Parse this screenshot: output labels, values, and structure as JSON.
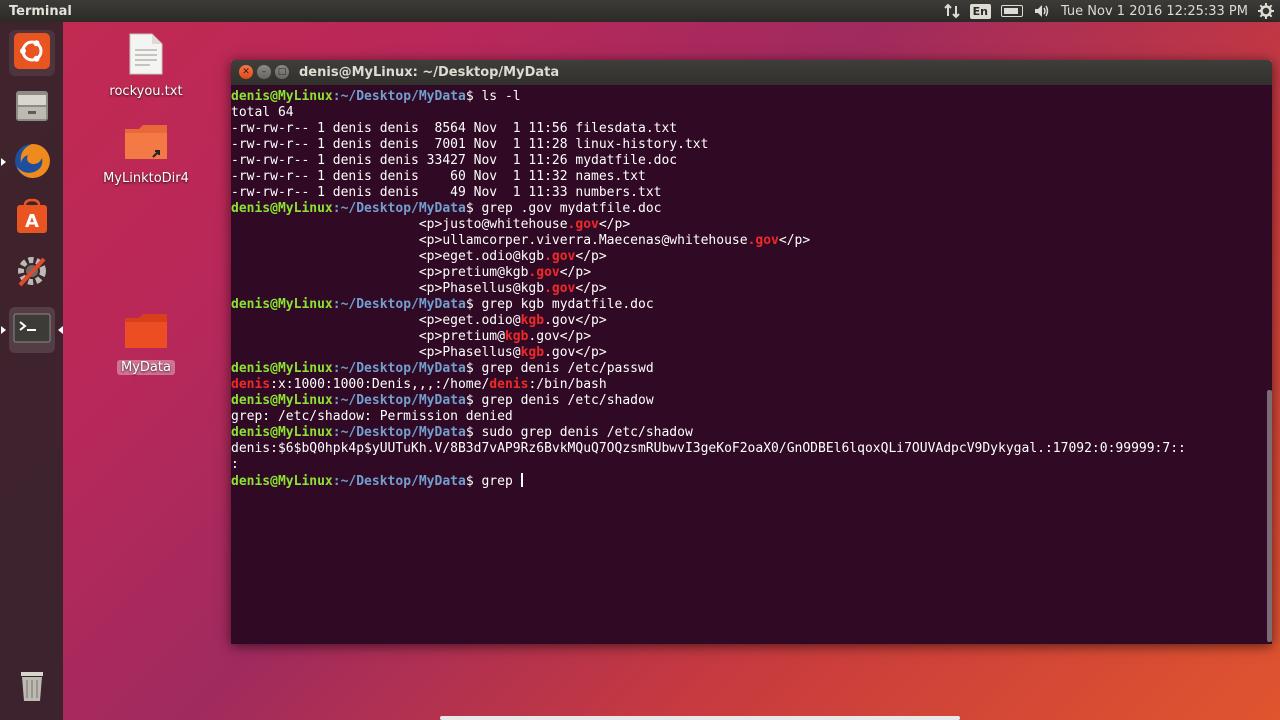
{
  "panel": {
    "app_title": "Terminal",
    "keyboard": "En",
    "datetime": "Tue Nov  1 2016 12:25:33 PM"
  },
  "launcher": {
    "items": [
      {
        "name": "dash-home",
        "icon": "ubuntu-logo-icon"
      },
      {
        "name": "files",
        "icon": "file-manager-icon"
      },
      {
        "name": "firefox",
        "icon": "firefox-icon"
      },
      {
        "name": "software-center",
        "icon": "software-center-icon"
      },
      {
        "name": "system-settings",
        "icon": "settings-icon"
      },
      {
        "name": "terminal",
        "icon": "terminal-icon"
      },
      {
        "name": "trash",
        "icon": "trash-icon"
      }
    ]
  },
  "desktop": {
    "icons": [
      {
        "label": "rockyou.txt"
      },
      {
        "label": "MyLinktoDir4"
      },
      {
        "label": "MyData"
      }
    ]
  },
  "window": {
    "title": "denis@MyLinux: ~/Desktop/MyData"
  },
  "terminal": {
    "user": "denis@MyLinux",
    "path": ":~/Desktop/MyData",
    "lines": [
      {
        "t": "p",
        "cmd": "$ ls -l"
      },
      {
        "t": "o",
        "text": "total 64"
      },
      {
        "t": "o",
        "text": "-rw-rw-r-- 1 denis denis  8564 Nov  1 11:56 filesdata.txt"
      },
      {
        "t": "o",
        "text": "-rw-rw-r-- 1 denis denis  7001 Nov  1 11:28 linux-history.txt"
      },
      {
        "t": "o",
        "text": "-rw-rw-r-- 1 denis denis 33427 Nov  1 11:26 mydatfile.doc"
      },
      {
        "t": "o",
        "text": "-rw-rw-r-- 1 denis denis    60 Nov  1 11:32 names.txt"
      },
      {
        "t": "o",
        "text": "-rw-rw-r-- 1 denis denis    49 Nov  1 11:33 numbers.txt"
      },
      {
        "t": "p",
        "cmd": "$ grep .gov mydatfile.doc"
      },
      {
        "t": "h",
        "pre": "                        <p>justo@whitehouse",
        "hl": ".gov",
        "post": "</p>"
      },
      {
        "t": "h",
        "pre": "                        <p>ullamcorper.viverra.Maecenas@whitehouse",
        "hl": ".gov",
        "post": "</p>"
      },
      {
        "t": "h",
        "pre": "                        <p>eget.odio@kgb",
        "hl": ".gov",
        "post": "</p>"
      },
      {
        "t": "h",
        "pre": "                        <p>pretium@kgb",
        "hl": ".gov",
        "post": "</p>"
      },
      {
        "t": "h",
        "pre": "                        <p>Phasellus@kgb",
        "hl": ".gov",
        "post": "</p>"
      },
      {
        "t": "p",
        "cmd": "$ grep kgb mydatfile.doc"
      },
      {
        "t": "h",
        "pre": "                        <p>eget.odio@",
        "hl": "kgb",
        "post": ".gov</p>"
      },
      {
        "t": "h",
        "pre": "                        <p>pretium@",
        "hl": "kgb",
        "post": ".gov</p>"
      },
      {
        "t": "h",
        "pre": "                        <p>Phasellus@",
        "hl": "kgb",
        "post": ".gov</p>"
      },
      {
        "t": "p",
        "cmd": "$ grep denis /etc/passwd"
      },
      {
        "t": "h2",
        "hl1": "denis",
        "mid": ":x:1000:1000:Denis,,,:/home/",
        "hl2": "denis",
        "post": ":/bin/bash"
      },
      {
        "t": "p",
        "cmd": "$ grep denis /etc/shadow"
      },
      {
        "t": "o",
        "text": "grep: /etc/shadow: Permission denied"
      },
      {
        "t": "p",
        "cmd": "$ sudo grep denis /etc/shadow"
      },
      {
        "t": "o",
        "text": "denis:$6$bQ0hpk4p$yUUTuKh.V/8B3d7vAP9Rz6BvkMQuQ7OQzsmRUbwvI3geKoF2oaX0/GnODBEl6lqoxQLi7OUVAdpcV9Dykygal.:17092:0:99999:7::"
      },
      {
        "t": "o",
        "text": ":"
      },
      {
        "t": "c",
        "cmd": "$ grep "
      }
    ]
  }
}
